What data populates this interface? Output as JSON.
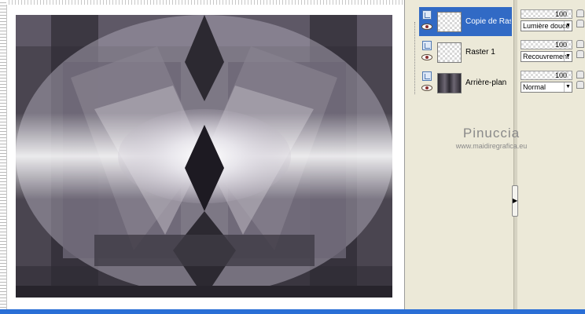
{
  "layers": [
    {
      "name": "Copie de Raster",
      "opacity": "100",
      "blend_mode": "Lumière douce",
      "selected": true,
      "thumb": "transparent"
    },
    {
      "name": "Raster 1",
      "opacity": "100",
      "blend_mode": "Recouvrement",
      "selected": false,
      "thumb": "transparent"
    },
    {
      "name": "Arrière-plan",
      "opacity": "100",
      "blend_mode": "Normal",
      "selected": false,
      "thumb": "dark"
    }
  ],
  "watermark": {
    "name": "Pinuccia",
    "url": "www.maidiregrafica.eu"
  },
  "colors": {
    "selection": "#316ac5",
    "panel_bg": "#ece9d8",
    "bottom_bar": "#2a6fd6"
  },
  "icons": [
    "raster-layer-icon",
    "visibility-eye-icon",
    "collapse-arrow-icon"
  ]
}
